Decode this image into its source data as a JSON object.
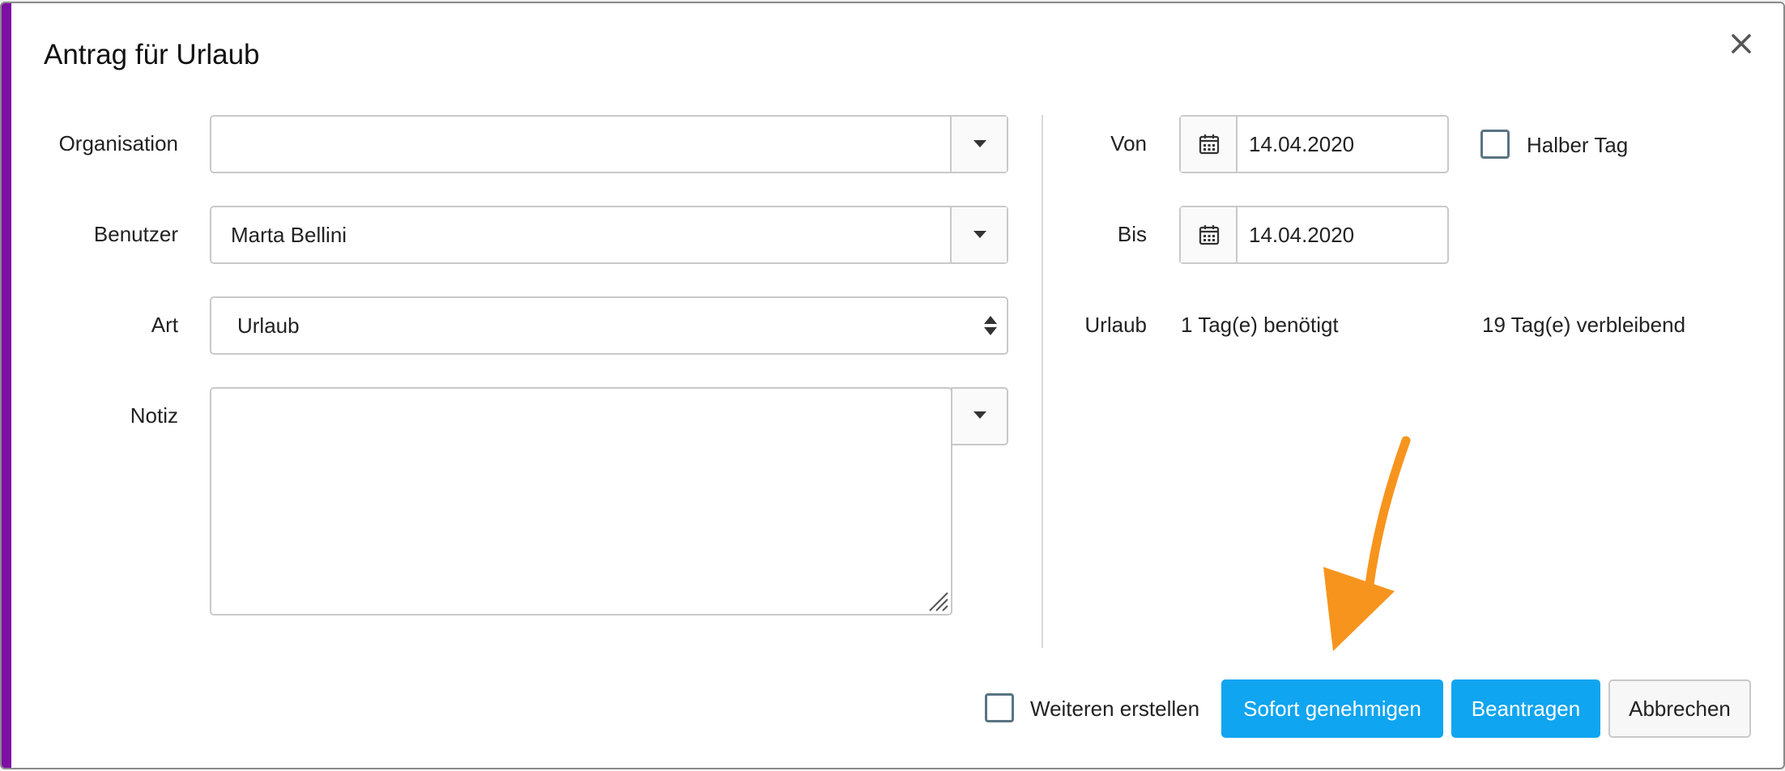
{
  "dialog": {
    "title": "Antrag für Urlaub",
    "accent_color": "#7e0fa5",
    "close_icon": "close-icon"
  },
  "form_left": {
    "organisation": {
      "label": "Organisation",
      "value": ""
    },
    "benutzer": {
      "label": "Benutzer",
      "value": "Marta Bellini"
    },
    "art": {
      "label": "Art",
      "value": "Urlaub"
    },
    "notiz": {
      "label": "Notiz",
      "value": ""
    }
  },
  "form_right": {
    "von": {
      "label": "Von",
      "value": "14.04.2020",
      "icon": "calendar-icon"
    },
    "bis": {
      "label": "Bis",
      "value": "14.04.2020",
      "icon": "calendar-icon"
    },
    "halber_tag": {
      "label": "Halber Tag",
      "checked": false
    },
    "urlaub": {
      "label": "Urlaub",
      "needed": "1 Tag(e) benötigt",
      "remaining": "19 Tag(e) verbleibend"
    }
  },
  "footer": {
    "weiteren_erstellen": {
      "label": "Weiteren erstellen",
      "checked": false
    },
    "approve_label": "Sofort genehmigen",
    "request_label": "Beantragen",
    "cancel_label": "Abbrechen",
    "primary_color": "#10a5f0"
  },
  "annotation": {
    "arrow_color": "#f7941d",
    "arrow_icon": "orange-arrow-icon"
  }
}
